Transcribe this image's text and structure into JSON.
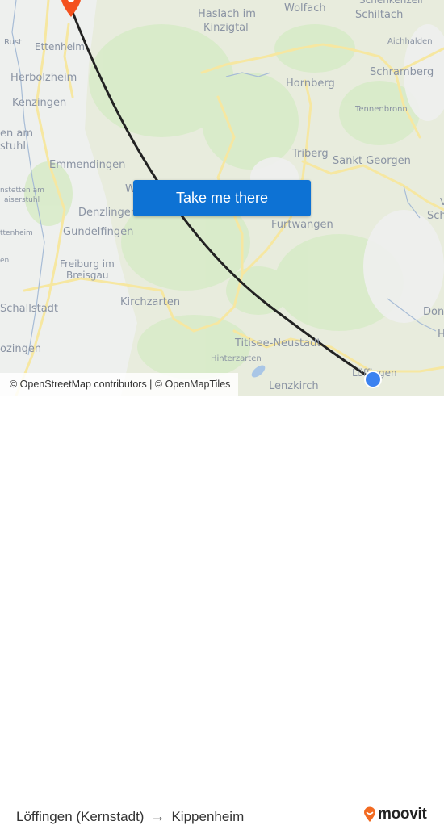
{
  "map": {
    "places": [
      {
        "name": "Rust",
        "size": "sm"
      },
      {
        "name": "Ettenheim",
        "size": "md"
      },
      {
        "name": "Herbolzheim",
        "size": "lg"
      },
      {
        "name": "Kenzingen",
        "size": "lg"
      },
      {
        "name": "en am",
        "size": "md"
      },
      {
        "name": "stuhl",
        "size": "md"
      },
      {
        "name": "Emmendingen",
        "size": "lg"
      },
      {
        "name": "nstetten am",
        "size": "xs"
      },
      {
        "name": "aiserstuhl",
        "size": "xs"
      },
      {
        "name": "Denzlingen",
        "size": "lg"
      },
      {
        "name": "Gundelfingen",
        "size": "lg"
      },
      {
        "name": "ttenheim",
        "size": "xs"
      },
      {
        "name": "en",
        "size": "xs"
      },
      {
        "name": "Freiburg im",
        "size": "md"
      },
      {
        "name": "Breisgau",
        "size": "md"
      },
      {
        "name": "Schallstadt",
        "size": "lg"
      },
      {
        "name": "Kirchzarten",
        "size": "lg"
      },
      {
        "name": "ozingen",
        "size": "lg"
      },
      {
        "name": "Haslach im",
        "size": "lg"
      },
      {
        "name": "Kinzigtal",
        "size": "lg"
      },
      {
        "name": "Wolfach",
        "size": "lg"
      },
      {
        "name": "Schenkenzell",
        "size": "md"
      },
      {
        "name": "Schiltach",
        "size": "lg"
      },
      {
        "name": "Aichhalden",
        "size": "sm"
      },
      {
        "name": "Schramberg",
        "size": "lg"
      },
      {
        "name": "Hornberg",
        "size": "lg"
      },
      {
        "name": "Tennenbronn",
        "size": "sm"
      },
      {
        "name": "Triberg",
        "size": "lg"
      },
      {
        "name": "Sankt Georgen",
        "size": "lg"
      },
      {
        "name": "W",
        "size": "lg"
      },
      {
        "name": "Furtwangen",
        "size": "lg"
      },
      {
        "name": "V",
        "size": "md"
      },
      {
        "name": "Sch",
        "size": "lg"
      },
      {
        "name": "Don",
        "size": "lg"
      },
      {
        "name": "H",
        "size": "lg"
      },
      {
        "name": "Titisee-Neustadt",
        "size": "lg"
      },
      {
        "name": "Hinterzarten",
        "size": "sm"
      },
      {
        "name": "Lenzkirch",
        "size": "lg"
      },
      {
        "name": "Löffingen",
        "size": "md"
      }
    ],
    "origin_marker": {
      "label": "current-location",
      "color": "#3b82f0"
    },
    "destination_marker": {
      "label": "destination-pin",
      "color": "#f4511e"
    },
    "route_color": "#222222",
    "take_me_there": "Take me there",
    "attribution": "© OpenStreetMap contributors | © OpenMapTiles"
  },
  "footer": {
    "origin": "Löffingen (Kernstadt)",
    "arrow": "→",
    "destination": "Kippenheim",
    "brand": "moovit",
    "brand_color": "#f26a21"
  }
}
